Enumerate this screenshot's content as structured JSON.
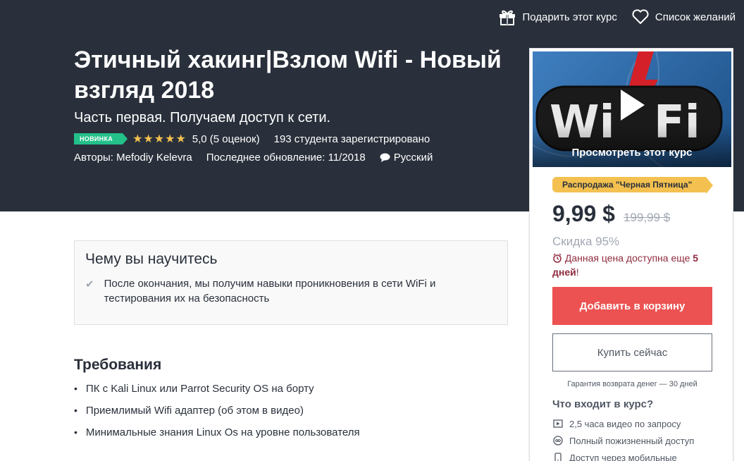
{
  "header": {
    "gift_label": "Подарить этот курс",
    "wishlist_label": "Список желаний"
  },
  "course": {
    "title": "Этичный хакинг|Взлом Wifi - Новый взгляд 2018",
    "subtitle": "Часть первая. Получаем доступ к сети.",
    "badge": "НОВИНКА",
    "stars": 5,
    "rating_text": "5,0 (5 оценок)",
    "students": "193 студента зарегистрировано",
    "authors": "Авторы: Mefodiy Kelevra",
    "updated": "Последнее обновление: 11/2018",
    "language": "Русский"
  },
  "learn": {
    "title": "Чему вы научитесь",
    "items": [
      "После окончания, мы получим навыки проникновения в сети WiFi и тестирования их на безопасность"
    ]
  },
  "requirements": {
    "title": "Требования",
    "items": [
      "ПК с Kali Linux или Parrot Security OS на борту",
      "Приемлимый Wifi адаптер (об этом в видео)",
      "Минимальные знания Linux Os на уровне пользователя"
    ]
  },
  "sidebar": {
    "preview_label": "Просмотреть этот курс",
    "sale_tag": "Распродажа \"Черная Пятница\"",
    "price_now": "9,99 $",
    "price_old": "199,99 $",
    "discount": "Скидка 95%",
    "timer_text": "Данная цена доступна еще ",
    "timer_days": "5 дней",
    "timer_end": "!",
    "add_to_cart": "Добавить в корзину",
    "buy_now": "Купить сейчас",
    "guarantee": "Гарантия возврата денег — 30 дней",
    "includes_title": "Что входит в курс?",
    "includes": [
      {
        "icon": "video-icon",
        "label": "2,5 часа видео по запросу"
      },
      {
        "icon": "infinity-icon",
        "label": "Полный пожизненный доступ"
      },
      {
        "icon": "mobile-icon",
        "label": "Доступ через мобильные"
      }
    ]
  },
  "colors": {
    "hero_bg": "#29303b",
    "accent_red": "#ec5252",
    "badge_green": "#23c08a",
    "star_yellow": "#f4c150",
    "timer_red": "#8f2b3e"
  }
}
